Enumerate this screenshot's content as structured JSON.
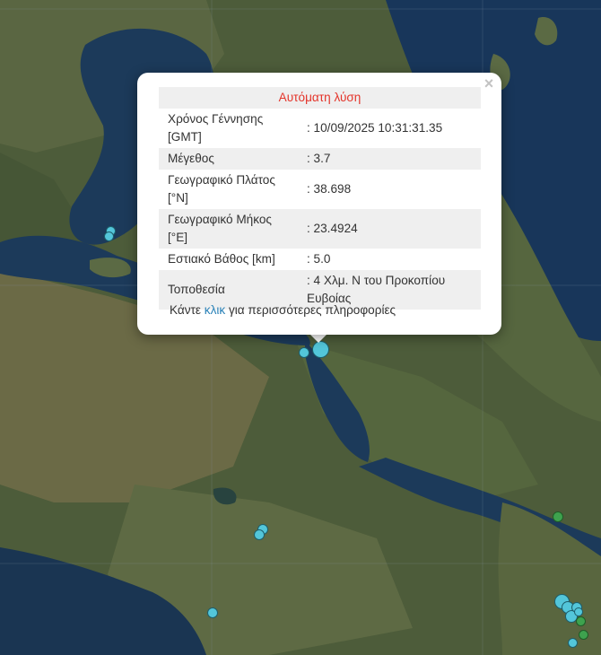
{
  "popup": {
    "header": "Αυτόματη λύση",
    "close_symbol": "×",
    "rows": [
      {
        "label": "Χρόνος Γέννησης [GMT]",
        "value": ": 10/09/2025 10:31:31.35"
      },
      {
        "label": "Μέγεθος",
        "value": ": 3.7"
      },
      {
        "label": "Γεωγραφικό Πλάτος [°N]",
        "value": ": 38.698"
      },
      {
        "label": "Γεωγραφικό Μήκος [°E]",
        "value": ": 23.4924"
      },
      {
        "label": "Εστιακό Βάθος [km]",
        "value": ": 5.0"
      },
      {
        "label": "Τοποθεσία",
        "value": ": 4 Χλμ. N του Προκοπίου Ευβοίας"
      }
    ],
    "more_prefix": "Κάντε",
    "more_link": "κλικ",
    "more_suffix": "για περισσότερες πληροφορίες"
  },
  "colors": {
    "header_text": "#e4342a",
    "link": "#2a82b8",
    "marker_recent": "#53c6da",
    "marker_older": "#3ea24e",
    "sea": "#1c3a5a",
    "land": "#4d5c3a"
  }
}
